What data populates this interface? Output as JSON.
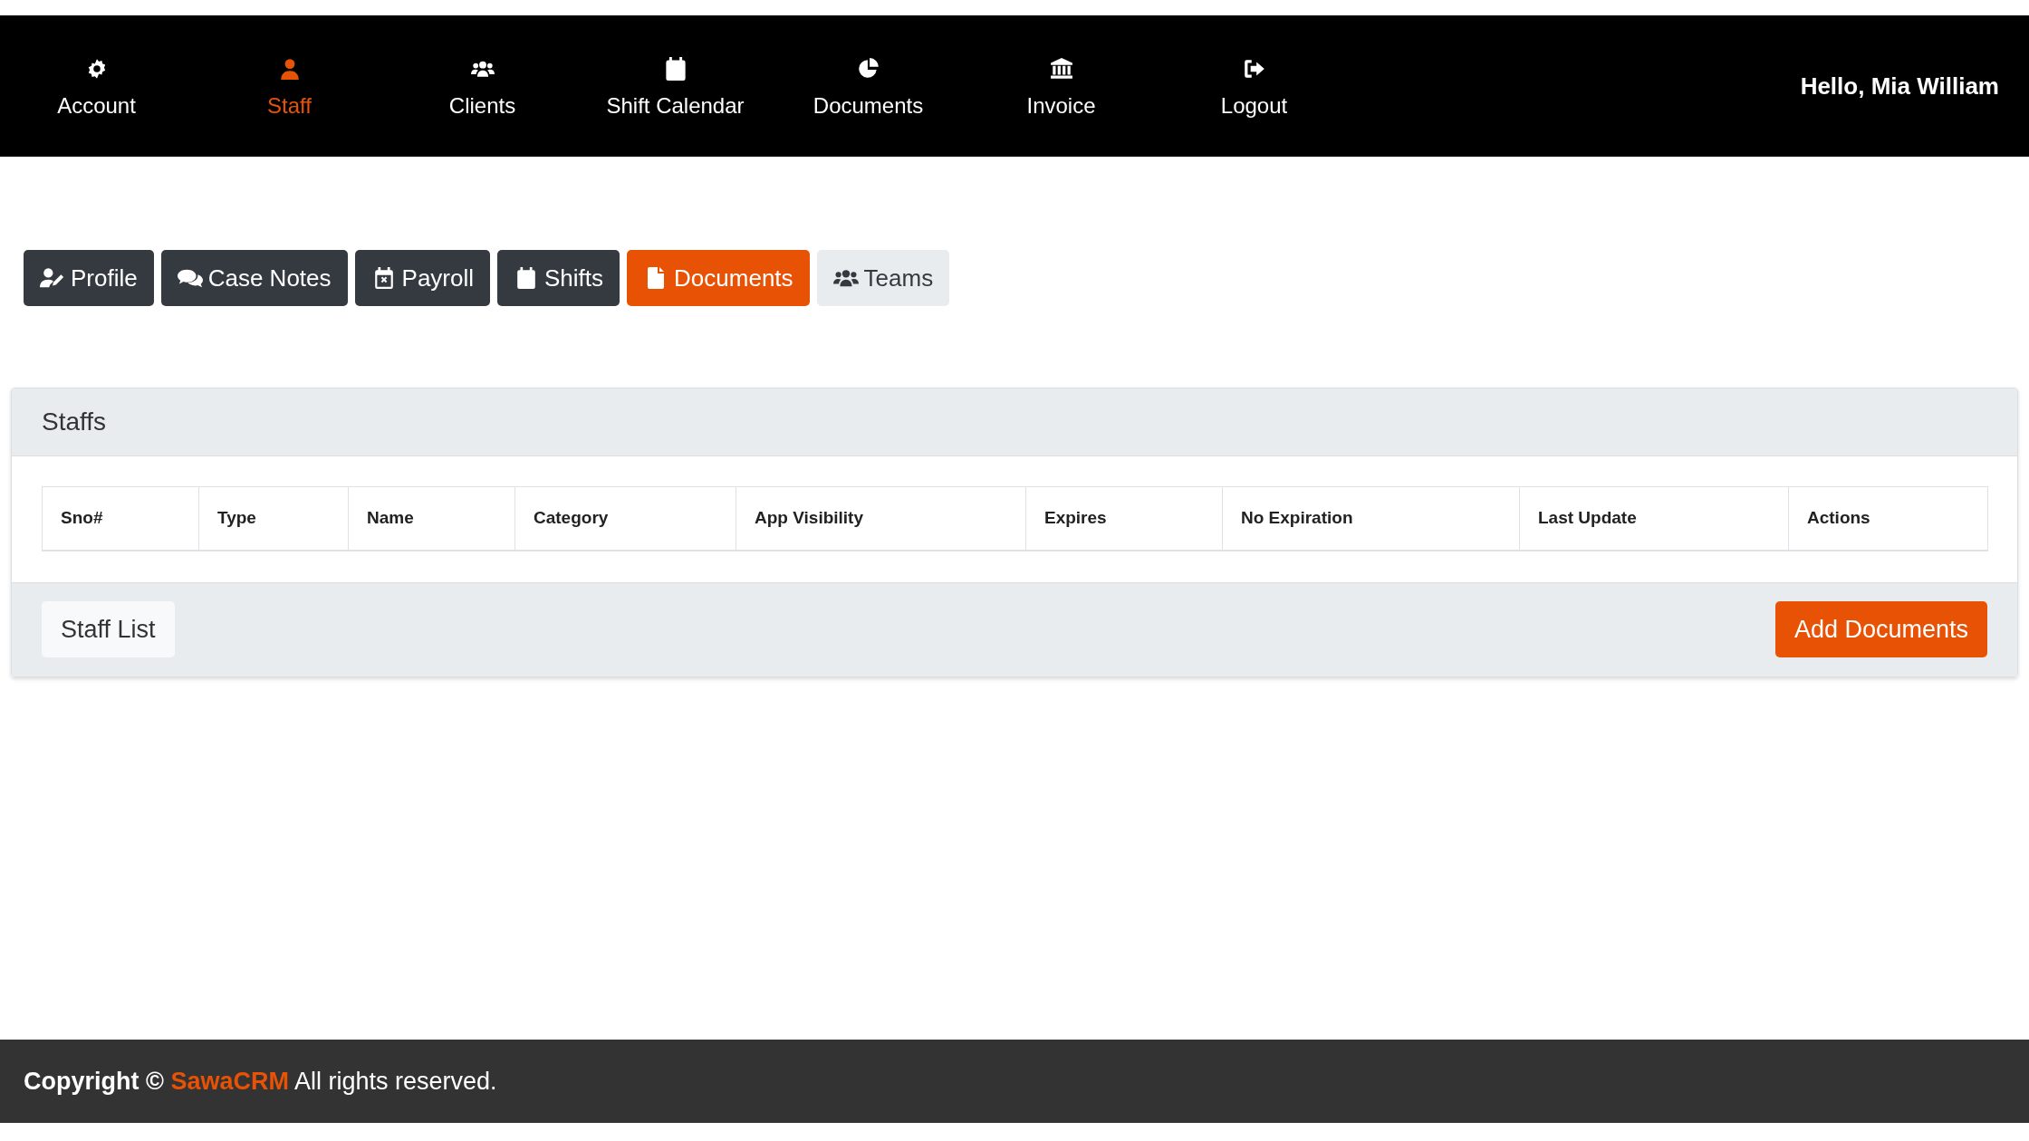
{
  "nav": {
    "items": [
      {
        "label": "Account",
        "selected": false
      },
      {
        "label": "Staff",
        "selected": true
      },
      {
        "label": "Clients",
        "selected": false
      },
      {
        "label": "Shift Calendar",
        "selected": false
      },
      {
        "label": "Documents",
        "selected": false
      },
      {
        "label": "Invoice",
        "selected": false
      },
      {
        "label": "Logout",
        "selected": false
      }
    ],
    "greeting": "Hello, Mia William"
  },
  "tabs": [
    {
      "label": "Profile",
      "kind": "dark",
      "selected": false
    },
    {
      "label": "Case Notes",
      "kind": "dark",
      "selected": false
    },
    {
      "label": "Payroll",
      "kind": "dark",
      "selected": false
    },
    {
      "label": "Shifts",
      "kind": "dark",
      "selected": false
    },
    {
      "label": "Documents",
      "kind": "dark",
      "selected": true
    },
    {
      "label": "Teams",
      "kind": "light",
      "selected": false
    }
  ],
  "card": {
    "title": "Staffs",
    "table": {
      "columns": [
        "Sno#",
        "Type",
        "Name",
        "Category",
        "App Visibility",
        "Expires",
        "No Expiration",
        "Last Update",
        "Actions"
      ]
    },
    "buttons": [
      {
        "label": "Staff List",
        "kind": "secondary"
      },
      {
        "label": "Add Documents",
        "kind": "primary"
      }
    ]
  },
  "footer": {
    "prefix": "Copyright ©",
    "brand": "SawaCRM",
    "suffix": "All rights reserved."
  }
}
